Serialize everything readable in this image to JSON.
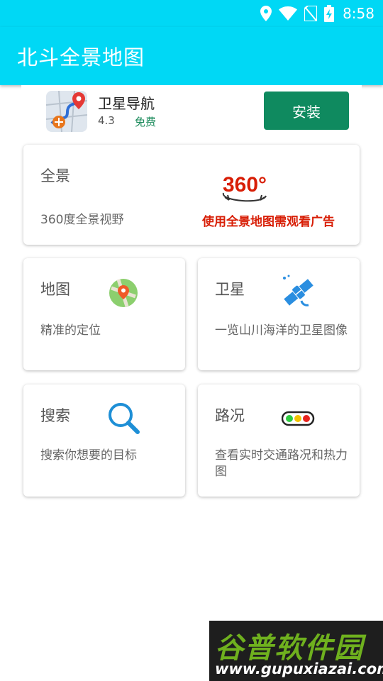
{
  "status_bar": {
    "time": "8:58"
  },
  "app_bar": {
    "title": "北斗全景地图"
  },
  "ad": {
    "app_name": "卫星导航",
    "rating": "4.3",
    "price": "免费",
    "install_label": "安装"
  },
  "cards": {
    "panorama": {
      "title": "全景",
      "description": "360度全景视野",
      "badge": "360°",
      "warning": "使用全景地图需观看广告"
    },
    "map": {
      "title": "地图",
      "description": "精准的定位"
    },
    "satellite": {
      "title": "卫星",
      "description": "一览山川海洋的卫星图像"
    },
    "search": {
      "title": "搜索",
      "description": "搜索你想要的目标"
    },
    "traffic": {
      "title": "路况",
      "description": "查看实时交通路况和热力图"
    }
  },
  "watermark": {
    "line1": "谷普软件园",
    "line2": "www.gupuxiazai.com"
  },
  "colors": {
    "primary": "#00d8f5",
    "install_button": "#0f8a5f",
    "warning_text": "#d81e06",
    "search_icon": "#1e8fd6",
    "satellite_icon": "#2a8ee0"
  }
}
